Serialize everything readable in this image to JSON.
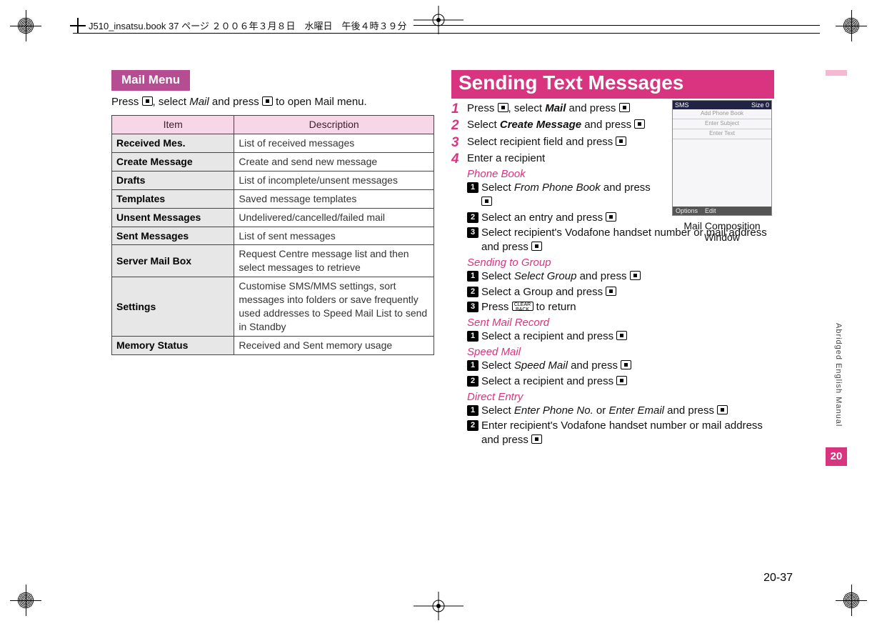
{
  "header_line": "J510_insatsu.book  37 ページ  ２００６年３月８日　水曜日　午後４時３９分",
  "side_label": "Abridged English Manual",
  "side_num": "20",
  "page_num": "20-37",
  "left": {
    "tab": "Mail Menu",
    "intro_1": "Press ",
    "intro_2": ", select ",
    "intro_mail": "Mail",
    "intro_3": " and press ",
    "intro_4": " to open Mail menu.",
    "th_item": "Item",
    "th_desc": "Description",
    "rows": [
      {
        "item": "Received Mes.",
        "desc": "List of received messages"
      },
      {
        "item": "Create Message",
        "desc": "Create and send new message"
      },
      {
        "item": "Drafts",
        "desc": "List of incomplete/unsent messages"
      },
      {
        "item": "Templates",
        "desc": "Saved message templates"
      },
      {
        "item": "Unsent Messages",
        "desc": "Undelivered/cancelled/failed mail"
      },
      {
        "item": "Sent Messages",
        "desc": "List of sent messages"
      },
      {
        "item": "Server Mail Box",
        "desc": "Request Centre message list and then select messages to retrieve"
      },
      {
        "item": "Settings",
        "desc": "Customise SMS/MMS settings, sort messages into folders or save frequently used addresses to Speed Mail List to send in Standby"
      },
      {
        "item": "Memory Status",
        "desc": "Received and Sent memory usage"
      }
    ]
  },
  "right": {
    "title": "Sending Text Messages",
    "s1_a": "Press ",
    "s1_b": ", select ",
    "s1_mail": "Mail",
    "s1_c": " and press ",
    "s2_a": "Select ",
    "s2_create": "Create Message",
    "s2_b": " and press ",
    "s3_a": "Select recipient field and press ",
    "s4_a": "Enter a recipient",
    "pb_h": "Phone Book",
    "pb1_a": "Select ",
    "pb1_i": "From Phone Book",
    "pb1_b": " and press ",
    "pb2": "Select an entry and press ",
    "pb3": "Select recipient's Vodafone handset number or mail address and press ",
    "grp_h": "Sending to Group",
    "grp1_a": "Select ",
    "grp1_i": "Select Group",
    "grp1_b": " and press ",
    "grp2": "Select a Group and press ",
    "grp3_a": "Press ",
    "grp3_b": " to return",
    "smr_h": "Sent Mail Record",
    "smr1": "Select a recipient and press ",
    "spm_h": "Speed Mail",
    "spm1_a": "Select ",
    "spm1_i": "Speed Mail",
    "spm1_b": " and press ",
    "spm2": "Select a recipient and press ",
    "de_h": "Direct Entry",
    "de1_a": "Select ",
    "de1_i1": "Enter Phone No.",
    "de1_or": " or ",
    "de1_i2": "Enter Email",
    "de1_b": " and press ",
    "de2": "Enter recipient's Vodafone handset number or mail address and press ",
    "fig_caption": "Mail Composition Window",
    "fig_top_left": "SMS",
    "fig_top_right": "Size 0",
    "fig_row1": "Add Phone Book",
    "fig_row2": "Enter Subject",
    "fig_row3": "Enter Text",
    "fig_opt": "Options",
    "fig_edit": "Edit",
    "clear_label": "CLEAR BACK"
  }
}
